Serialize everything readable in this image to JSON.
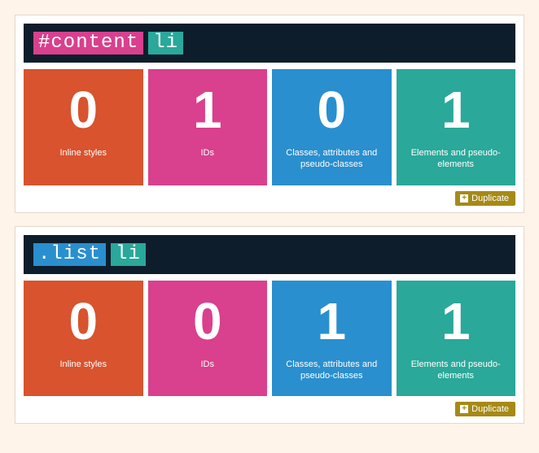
{
  "duplicate_label": "Duplicate",
  "score_labels": {
    "inline": "Inline styles",
    "ids": "IDs",
    "classes": "Classes, attributes and pseudo-classes",
    "elements": "Elements and pseudo-elements"
  },
  "panels": [
    {
      "selector_tokens": [
        {
          "text": "#content",
          "kind": "id"
        },
        {
          "text": "li",
          "kind": "elem"
        }
      ],
      "scores": {
        "inline": "0",
        "ids": "1",
        "classes": "0",
        "elements": "1"
      }
    },
    {
      "selector_tokens": [
        {
          "text": ".list",
          "kind": "class"
        },
        {
          "text": "li",
          "kind": "elem"
        }
      ],
      "scores": {
        "inline": "0",
        "ids": "0",
        "classes": "1",
        "elements": "1"
      }
    }
  ]
}
